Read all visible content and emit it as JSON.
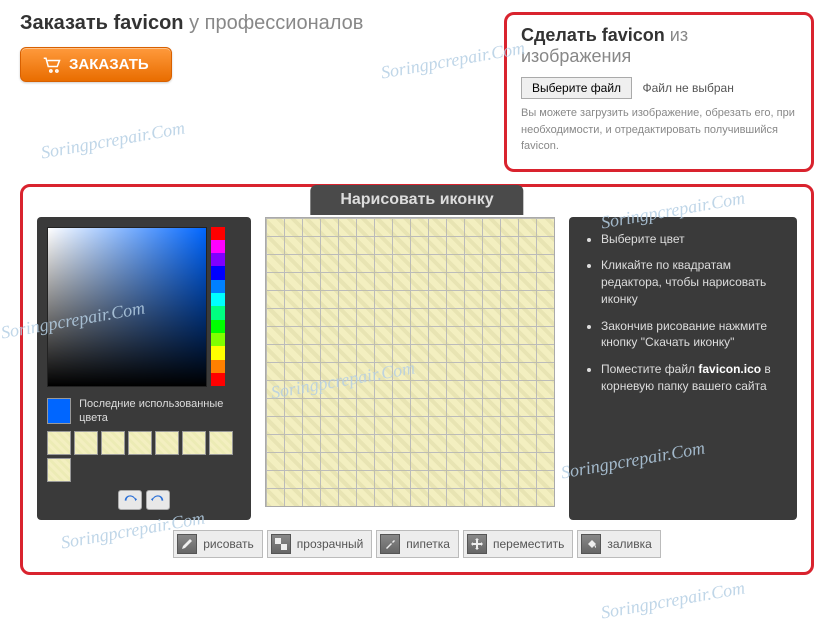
{
  "order": {
    "title_bold": "Заказать favicon",
    "title_light": "у профессионалов",
    "button": "ЗАКАЗАТЬ"
  },
  "make": {
    "title_bold": "Сделать favicon",
    "title_light": "из изображения",
    "file_button": "Выберите файл",
    "file_status": "Файл не выбран",
    "description": "Вы можете загрузить изображение, обрезать его, при необходимости, и отредактировать получившийся favicon."
  },
  "draw": {
    "title": "Нарисовать иконку",
    "recent_label": "Последние использованные цвета",
    "current_color": "#0066ff",
    "hue_colors": [
      "#ff0000",
      "#ff00ff",
      "#8000ff",
      "#0000ff",
      "#0080ff",
      "#00ffff",
      "#00ff80",
      "#00ff00",
      "#80ff00",
      "#ffff00",
      "#ff8000",
      "#ff0000"
    ],
    "instructions": [
      "Выберите цвет",
      "Кликайте по квадратам редактора, чтобы нарисовать иконку",
      "Закончив рисование нажмите кнопку \"Скачать иконку\"",
      "Поместите файл <b>favicon.ico</b> в корневую папку вашего сайта"
    ],
    "tools": {
      "draw": "рисовать",
      "transparent": "прозрачный",
      "eyedrop": "пипетка",
      "move": "переместить",
      "fill": "заливка"
    }
  },
  "watermark": "Soringpcrepair.Com"
}
